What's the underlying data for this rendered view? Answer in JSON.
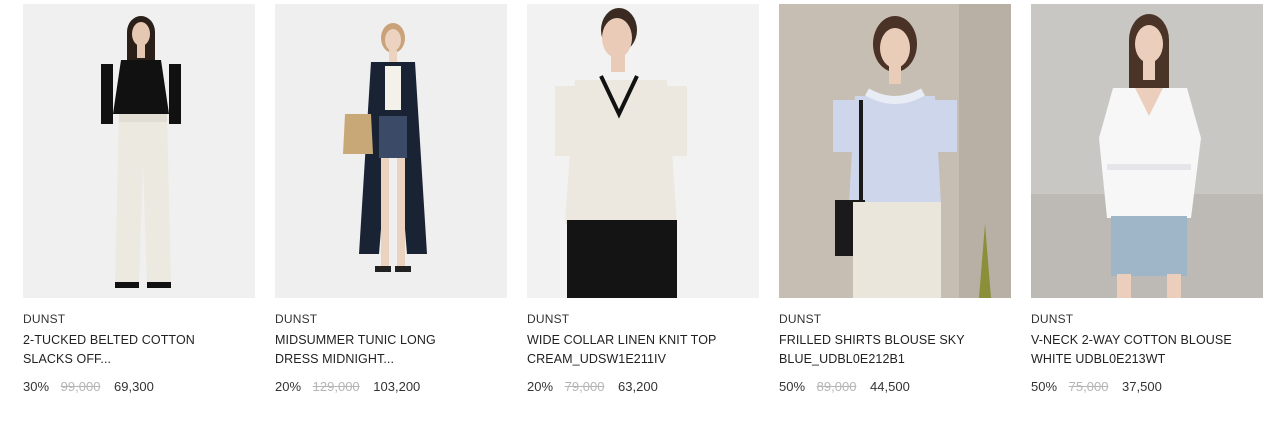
{
  "products": [
    {
      "brand": "DUNST",
      "name_line1": "2-TUCKED BELTED COTTON",
      "name_line2": "SLACKS OFF...",
      "discount": "30%",
      "original_price": "99,000",
      "sale_price": "69,300",
      "image": "model-black-knit-white-slacks"
    },
    {
      "brand": "DUNST",
      "name_line1": "MIDSUMMER TUNIC LONG",
      "name_line2": "DRESS MIDNIGHT...",
      "discount": "20%",
      "original_price": "129,000",
      "sale_price": "103,200",
      "image": "model-navy-long-tunic"
    },
    {
      "brand": "DUNST",
      "name_line1": "WIDE COLLAR LINEN KNIT TOP",
      "name_line2": "CREAM_UDSW1E211IV",
      "discount": "20%",
      "original_price": "79,000",
      "sale_price": "63,200",
      "image": "model-cream-knit-top"
    },
    {
      "brand": "DUNST",
      "name_line1": "FRILLED SHIRTS BLOUSE SKY",
      "name_line2": "BLUE_UDBL0E212B1",
      "discount": "50%",
      "original_price": "89,000",
      "sale_price": "44,500",
      "image": "model-sky-blue-blouse"
    },
    {
      "brand": "DUNST",
      "name_line1": "V-NECK 2-WAY COTTON BLOUSE",
      "name_line2": "WHITE UDBL0E213WT",
      "discount": "50%",
      "original_price": "75,000",
      "sale_price": "37,500",
      "image": "model-white-blouse-denim-shorts"
    }
  ]
}
